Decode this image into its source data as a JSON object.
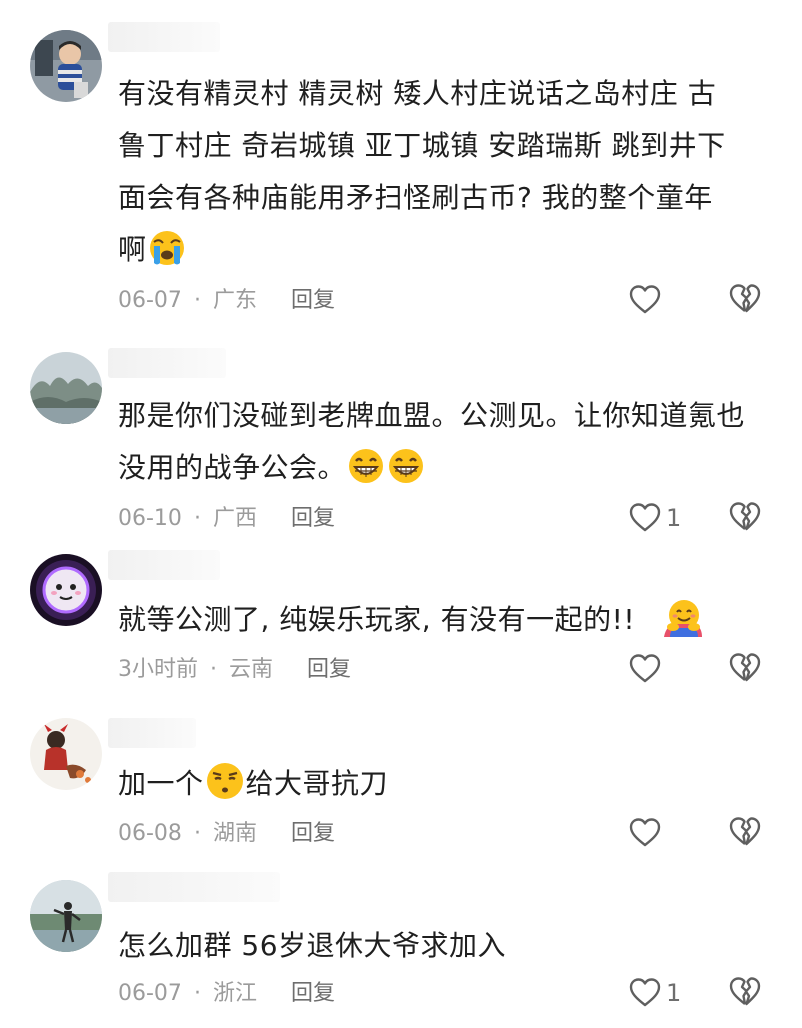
{
  "comments": [
    {
      "text_lines": [
        "有没有精灵村 精灵树 矮人村庄说话之岛村庄 古",
        "鲁丁村庄 奇岩城镇 亚丁城镇 安踏瑞斯 跳到井下",
        "面会有各种庙能用矛扫怪刷古币? 我的整个童年",
        "啊"
      ],
      "emojis": [
        "loudly-crying-face-emoji"
      ],
      "date": "06-07",
      "location": "广东",
      "reply_label": "回复",
      "like_count": ""
    },
    {
      "text_lines": [
        "那是你们没碰到老牌血盟。公测见。让你知道氪也",
        "没用的战争公会。"
      ],
      "emojis": [
        "grinning-face-emoji",
        "grinning-face-emoji"
      ],
      "date": "06-10",
      "location": "广西",
      "reply_label": "回复",
      "like_count": "1"
    },
    {
      "text_lines": [
        "就等公测了, 纯娱乐玩家, 有没有一起的!! "
      ],
      "emojis": [
        "hugging-face-emoji"
      ],
      "date": "3小时前",
      "location": "云南",
      "reply_label": "回复",
      "like_count": ""
    },
    {
      "text_lines": [
        "加一个",
        "给大哥抗刀"
      ],
      "emojis": [
        "smirking-face-emoji"
      ],
      "date": "06-08",
      "location": "湖南",
      "reply_label": "回复",
      "like_count": ""
    },
    {
      "text_lines": [
        "怎么加群  56岁退休大爷求加入"
      ],
      "emojis": [],
      "date": "06-07",
      "location": "浙江",
      "reply_label": "回复",
      "like_count": "1"
    }
  ],
  "icons": {
    "like": "heart-outline-icon",
    "dislike": "broken-heart-icon"
  },
  "colors": {
    "text": "#1f1f1f",
    "meta": "#9b9b9b",
    "reply": "#6e6e6e",
    "icon_stroke": "#5f5f5f",
    "emoji_yellow": "#fcc21b"
  }
}
